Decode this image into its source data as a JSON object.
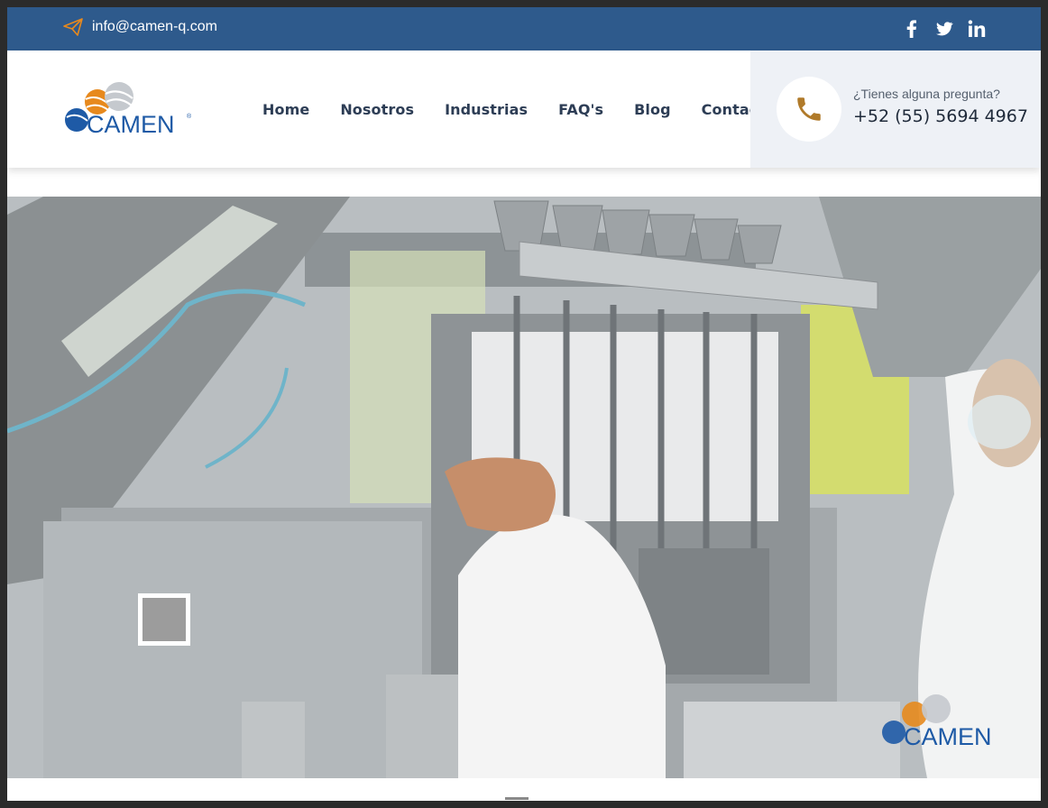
{
  "topbar": {
    "email": "info@camen-q.com",
    "email_icon": "paper-plane-icon",
    "social": [
      "facebook-icon",
      "twitter-icon",
      "linkedin-icon"
    ]
  },
  "header": {
    "logo_text": "CAMEN",
    "nav": [
      "Home",
      "Nosotros",
      "Industrias",
      "FAQ's",
      "Blog",
      "Contacto"
    ],
    "contact_question": "¿Tienes alguna pregunta?",
    "contact_phone": "+52 (55) 5694 4967",
    "phone_icon": "phone-icon"
  },
  "hero": {
    "image": "packaging-machine-photo",
    "watermark_text": "CAMEN"
  },
  "colors": {
    "topbar": "#2e5a8c",
    "accent_orange": "#e7891d",
    "brand_blue": "#1e5aa6",
    "phone_icon": "#b07a2a",
    "contact_bg": "#eef1f6"
  }
}
